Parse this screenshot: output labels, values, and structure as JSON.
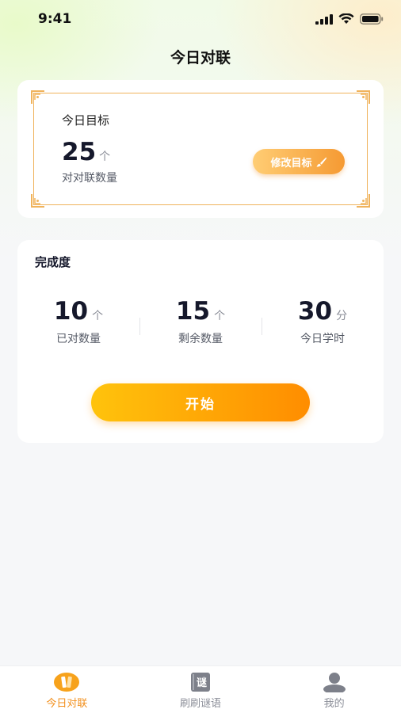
{
  "status_bar": {
    "time": "9:41"
  },
  "page": {
    "title": "今日对联"
  },
  "goal_card": {
    "label": "今日目标",
    "value": "25",
    "unit": "个",
    "subtitle": "对对联数量",
    "edit_label": "修改目标"
  },
  "progress_card": {
    "title": "完成度",
    "stats": [
      {
        "value": "10",
        "unit": "个",
        "label": "已对数量"
      },
      {
        "value": "15",
        "unit": "个",
        "label": "剩余数量"
      },
      {
        "value": "30",
        "unit": "分",
        "label": "今日学时"
      }
    ],
    "start_label": "开始"
  },
  "tabs": [
    {
      "label": "今日对联",
      "icon": "couplet-icon",
      "active": true
    },
    {
      "label": "刷刷谜语",
      "icon": "riddle-book-icon",
      "icon_text": "谜",
      "active": false
    },
    {
      "label": "我的",
      "icon": "user-icon",
      "active": false
    }
  ],
  "colors": {
    "accent": "#f28f1c",
    "button_start": "#ffc30c",
    "button_end": "#ff8d00",
    "frame": "#f0b35c"
  }
}
